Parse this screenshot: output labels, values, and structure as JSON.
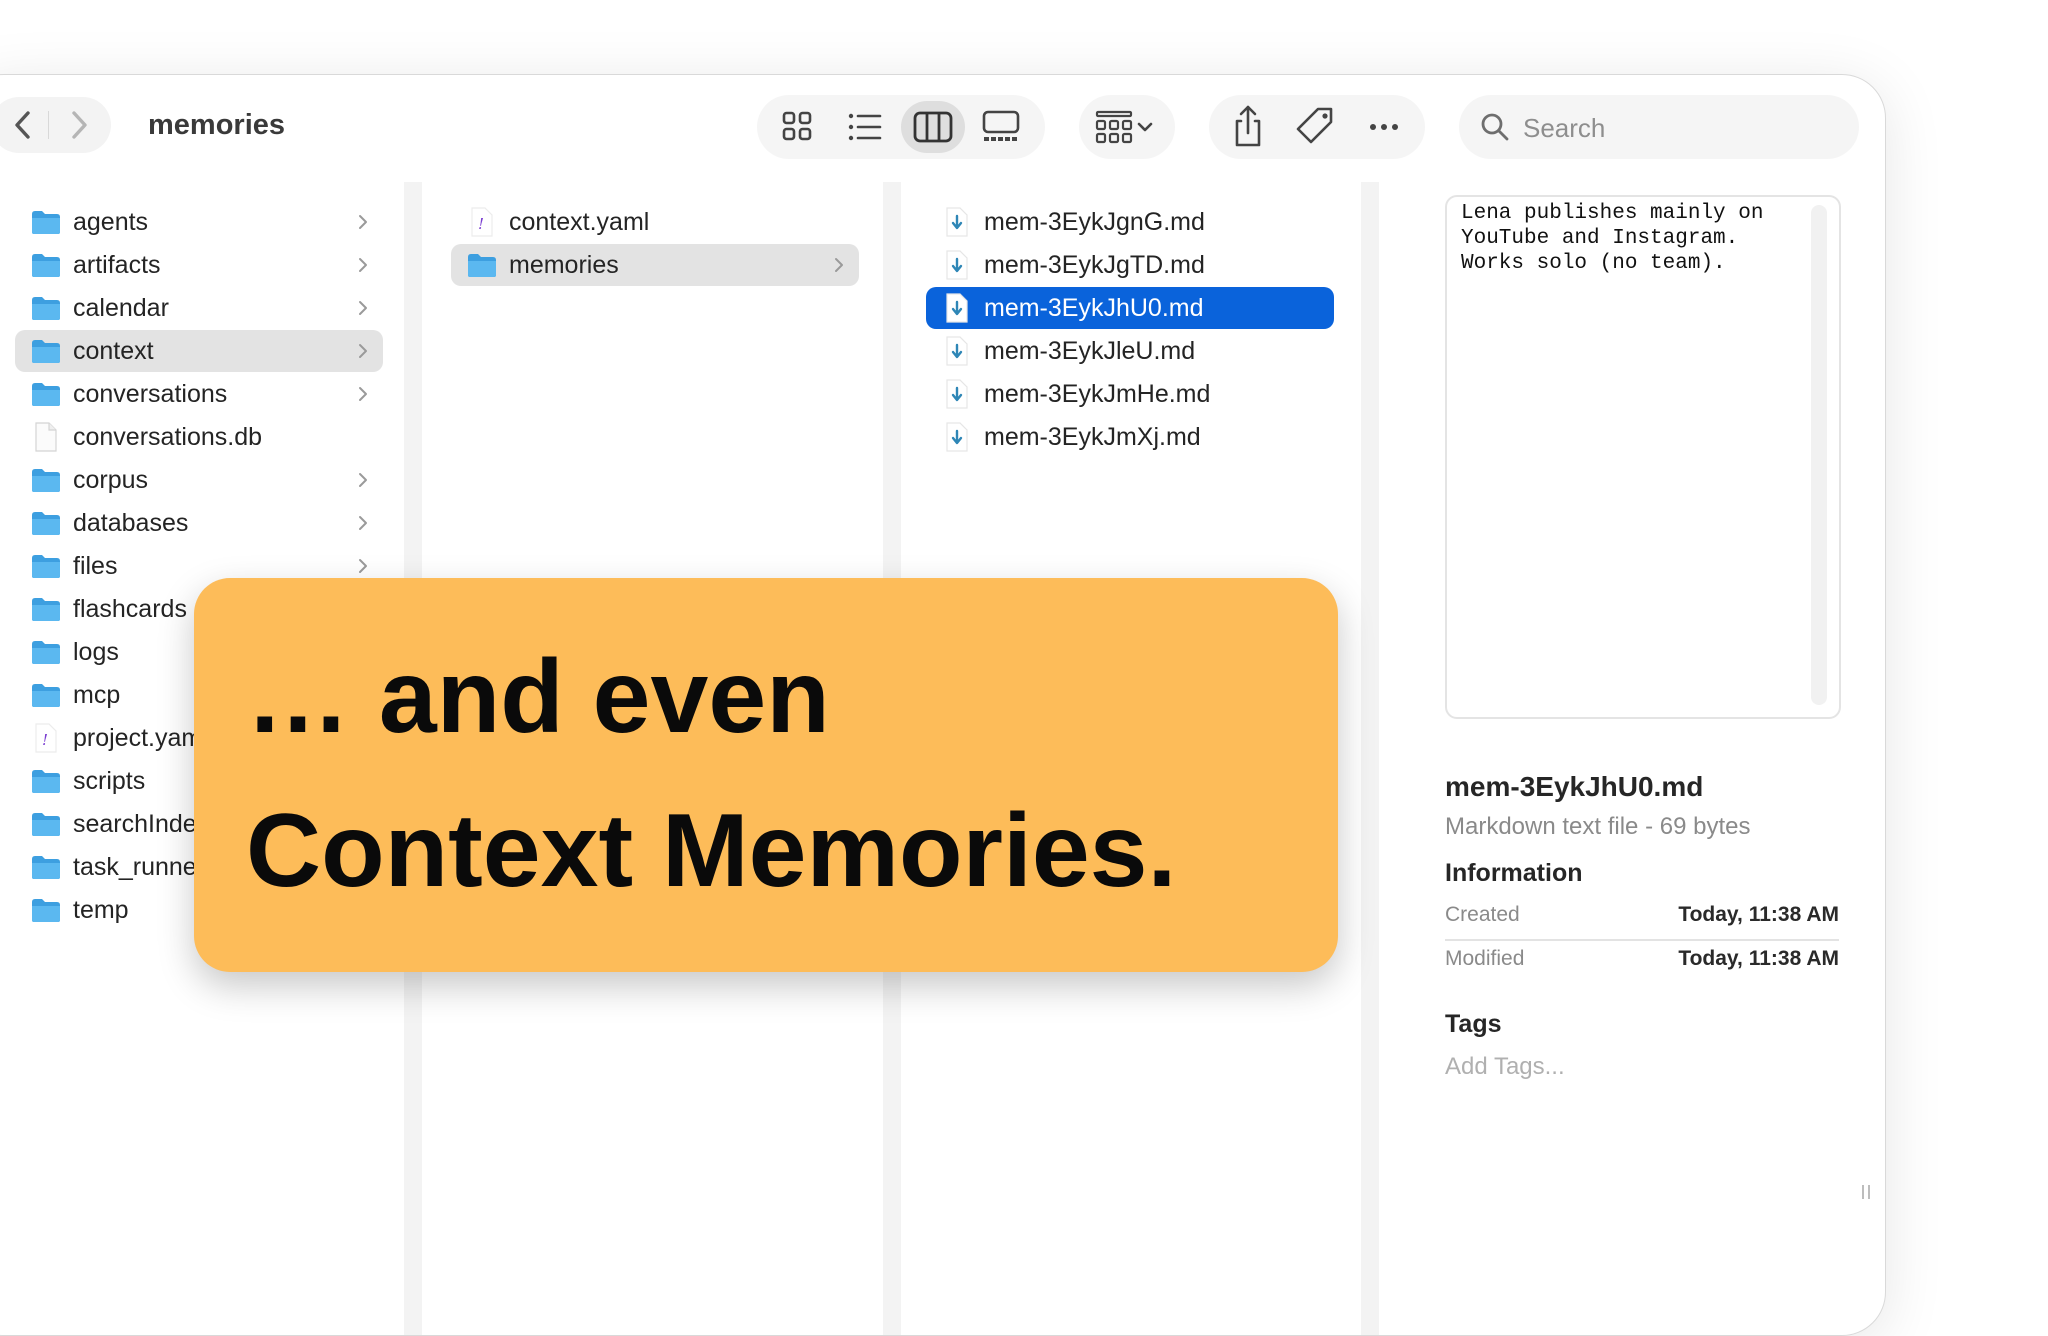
{
  "window": {
    "title": "memories"
  },
  "toolbar": {
    "back_icon": "chevron-left-icon",
    "forward_icon": "chevron-right-icon",
    "views": [
      "icon-view",
      "list-view",
      "column-view",
      "gallery-view"
    ],
    "active_view": "column-view",
    "search": {
      "placeholder": "Search",
      "value": ""
    }
  },
  "sidebar": {
    "items": [
      {
        "label": "agents",
        "type": "folder",
        "chevron": true
      },
      {
        "label": "artifacts",
        "type": "folder",
        "chevron": true
      },
      {
        "label": "calendar",
        "type": "folder",
        "chevron": true
      },
      {
        "label": "context",
        "type": "folder",
        "chevron": true,
        "highlighted": true
      },
      {
        "label": "conversations",
        "type": "folder",
        "chevron": true
      },
      {
        "label": "conversations.db",
        "type": "file",
        "chevron": false
      },
      {
        "label": "corpus",
        "type": "folder",
        "chevron": true
      },
      {
        "label": "databases",
        "type": "folder",
        "chevron": true
      },
      {
        "label": "files",
        "type": "folder",
        "chevron": true
      },
      {
        "label": "flashcards",
        "type": "folder",
        "chevron": true
      },
      {
        "label": "logs",
        "type": "folder",
        "chevron": true
      },
      {
        "label": "mcp",
        "type": "folder",
        "chevron": true
      },
      {
        "label": "project.yaml",
        "type": "yaml",
        "chevron": false
      },
      {
        "label": "scripts",
        "type": "folder",
        "chevron": true
      },
      {
        "label": "searchIndex",
        "type": "folder",
        "chevron": true
      },
      {
        "label": "task_runner",
        "type": "folder",
        "chevron": true
      },
      {
        "label": "temp",
        "type": "folder",
        "chevron": true
      }
    ]
  },
  "column2": {
    "items": [
      {
        "label": "context.yaml",
        "type": "yaml",
        "chevron": false
      },
      {
        "label": "memories",
        "type": "folder",
        "chevron": true,
        "highlighted": true
      }
    ]
  },
  "column3": {
    "items": [
      {
        "label": "mem-3EykJgnG.md",
        "type": "md"
      },
      {
        "label": "mem-3EykJgTD.md",
        "type": "md"
      },
      {
        "label": "mem-3EykJhU0.md",
        "type": "md",
        "selected": true
      },
      {
        "label": "mem-3EykJleU.md",
        "type": "md"
      },
      {
        "label": "mem-3EykJmHe.md",
        "type": "md"
      },
      {
        "label": "mem-3EykJmXj.md",
        "type": "md"
      }
    ]
  },
  "preview": {
    "content": "Lena publishes mainly on\nYouTube and Instagram.\nWorks solo (no team).",
    "file_name": "mem-3EykJhU0.md",
    "file_kind": "Markdown text file - 69 bytes",
    "info_heading": "Information",
    "created_label": "Created",
    "created_value": "Today, 11:38 AM",
    "modified_label": "Modified",
    "modified_value": "Today, 11:38 AM",
    "tags_heading": "Tags",
    "tags_placeholder": "Add Tags..."
  },
  "banner": {
    "line1": "… and even",
    "line2": "Context Memories."
  },
  "colors": {
    "selection": "#0a63db",
    "folder": "#3fa9ea",
    "banner": "#fdbc59"
  }
}
